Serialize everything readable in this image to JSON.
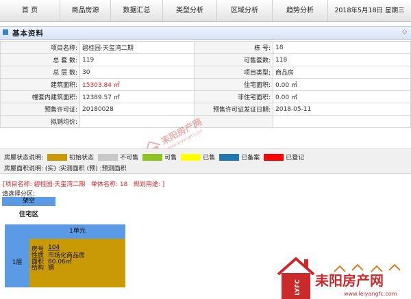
{
  "nav": {
    "items": [
      "首 页",
      "商品房源",
      "数据汇总",
      "类型分析",
      "区域分析",
      "趋势分析"
    ],
    "date": "2018年5月18日  星期三"
  },
  "panel": {
    "title": "基本资料",
    "ctrl": "◇"
  },
  "info": {
    "rows": [
      {
        "l1": "项目名称:",
        "v1": "碧桂园·天玺湾二期",
        "l2": "栋      号:",
        "v2": "18"
      },
      {
        "l1": "总 套 数:",
        "v1": "119",
        "l2": "可售套数:",
        "v2": "118"
      },
      {
        "l1": "总 层 数:",
        "v1": "30",
        "l2": "项目类型:",
        "v2": "商品房"
      },
      {
        "l1": "建筑面积:",
        "v1": "15303.84 ㎡",
        "l2": "住宅面积:",
        "v2": "0.00 ㎡"
      },
      {
        "l1": "幢套内建筑面积:",
        "v1": "12389.57 ㎡",
        "l2": "非住宅面积:",
        "v2": "0.00 ㎡"
      },
      {
        "l1": "预售许可证:",
        "v1": "20180028",
        "l2": "预售许可证发证日期:",
        "v2": "2018-05-11"
      },
      {
        "l1": "拟销均价:",
        "v1": "",
        "l2": "",
        "v2": ""
      }
    ]
  },
  "legend": {
    "label": "房屋状态说明:",
    "items": [
      {
        "color": "#c99a06",
        "text": "初始状态"
      },
      {
        "color": "#c8c8c8",
        "text": "不可售"
      },
      {
        "color": "#8ec21f",
        "text": "可售"
      },
      {
        "color": "#ffff00",
        "text": "已售"
      },
      {
        "color": "#1f78b4",
        "text": "已备案"
      },
      {
        "color": "#ff0000",
        "text": "已登记"
      }
    ],
    "area_line": "房屋面积说明:  (实) :实测面积  (预) :预测面积"
  },
  "project_line": {
    "open": "[",
    "name_label": "项目名称:",
    "name": "碧桂园·天玺湾二期",
    "unit_label": "单体名称:",
    "unit": "18",
    "use_label": "规划用途:",
    "close": "]"
  },
  "building": {
    "prompt": "请选择分区:",
    "button": "架空",
    "zone": "住宅区",
    "unit_header": "1单元",
    "floor": "1层",
    "room": {
      "room_label": "房号",
      "room_value": "104",
      "nature_label": "性质",
      "nature_value": "市场化商品房",
      "area_label": "面积",
      "area_value": "80.06㎡",
      "structure_label": "结构",
      "structure_value": "钢"
    }
  },
  "watermark": {
    "text": "耒阳房产网",
    "url": "www.leiyangfc.com"
  },
  "logo": {
    "text": "耒阳房产网",
    "side": "LYFC",
    "url": "www.leiyangfc.com"
  }
}
